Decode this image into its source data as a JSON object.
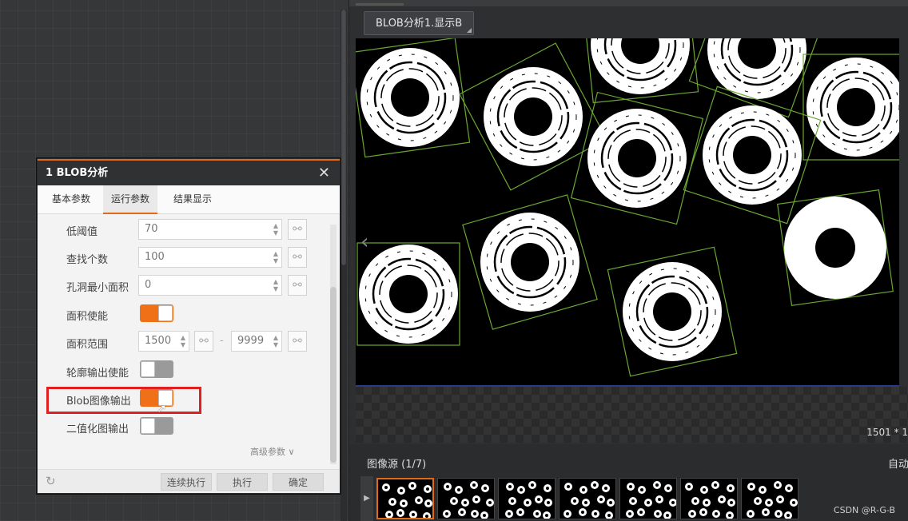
{
  "viewer": {
    "tab_title": "BLOB分析1.显示B",
    "resolution": "1501 * 1",
    "source_title": "图像源 (1/7)",
    "auto_label": "自动",
    "watermark": "CSDN @R-G-B",
    "thumbnail_count": 7
  },
  "dialog": {
    "title": "1 BLOB分析",
    "tabs": [
      "基本参数",
      "运行参数",
      "结果显示"
    ],
    "active_tab": "运行参数",
    "fields": {
      "low_threshold": {
        "label": "低阈值",
        "value": "70"
      },
      "find_count": {
        "label": "查找个数",
        "value": "100"
      },
      "min_hole_area": {
        "label": "孔洞最小面积",
        "value": "0"
      },
      "area_enable": {
        "label": "面积使能",
        "on": true
      },
      "area_range": {
        "label": "面积范围",
        "min": "1500",
        "sep": "-",
        "max": "9999"
      },
      "contour_output": {
        "label": "轮廓输出使能",
        "on": false
      },
      "blob_image_output": {
        "label": "Blob图像输出",
        "on": true
      },
      "binary_image_output": {
        "label": "二值化图输出",
        "on": false
      }
    },
    "advanced": "高级参数 ∨",
    "buttons": {
      "continuous": "连续执行",
      "run": "执行",
      "ok": "确定"
    }
  },
  "colors": {
    "accent": "#f07018",
    "highlight": "#e02020",
    "box": "#6aa832"
  }
}
